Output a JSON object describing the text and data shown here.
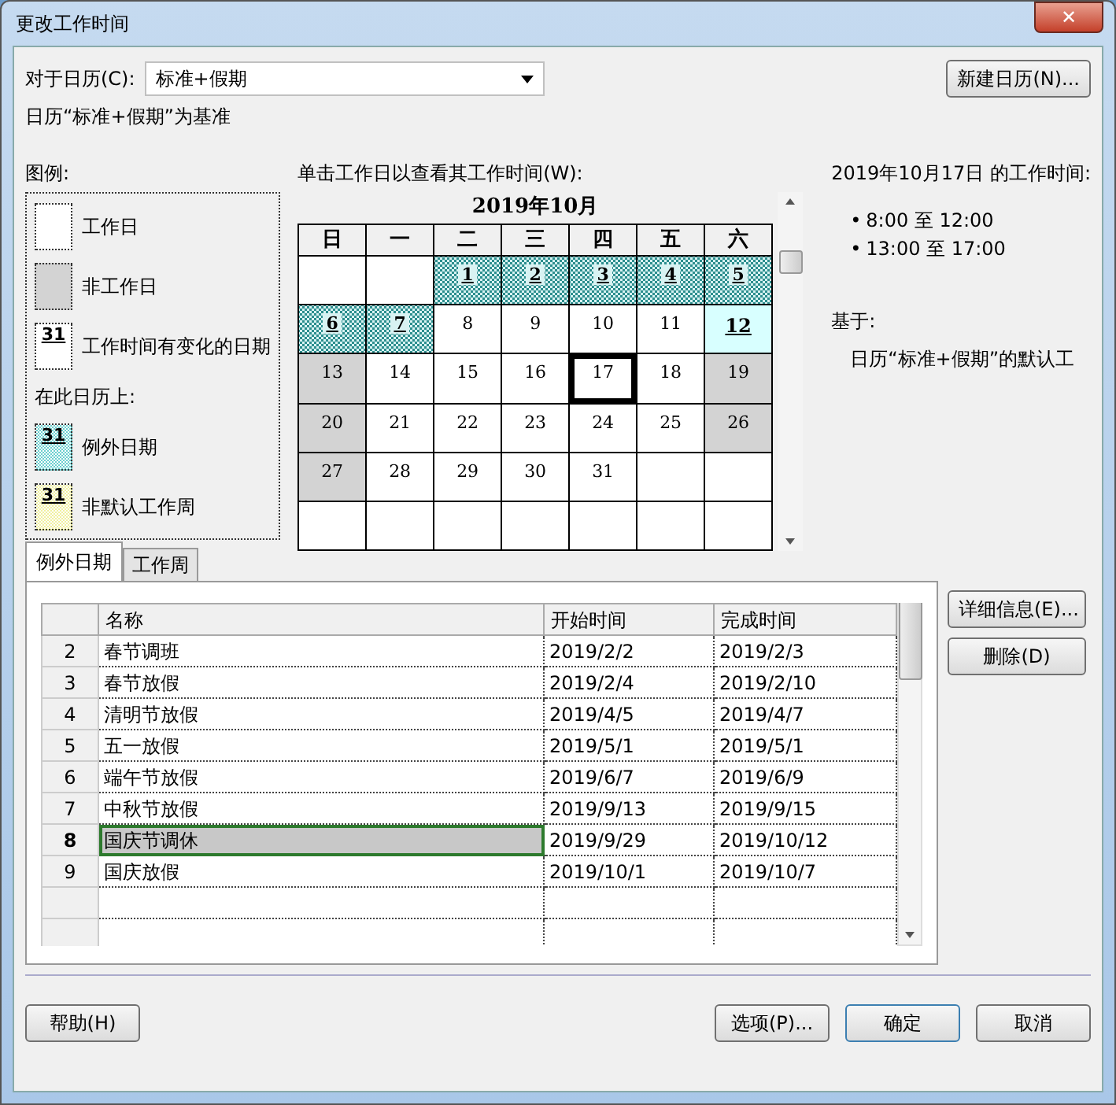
{
  "window": {
    "title": "更改工作时间",
    "close": "✕"
  },
  "calendar_field": {
    "label": "对于日历(C):",
    "value": "标准+假期"
  },
  "new_calendar_button": "新建日历(N)...",
  "base_note": "日历“标准+假期”为基准",
  "legend": {
    "title": "图例:",
    "subtitle": "在此日历上:",
    "items": [
      {
        "kind": "working",
        "label": "工作日"
      },
      {
        "kind": "nonworking",
        "label": "非工作日"
      },
      {
        "kind": "changed",
        "label": "工作时间有变化的日期",
        "sample": "31"
      },
      {
        "kind": "exception",
        "label": "例外日期",
        "sample": "31"
      },
      {
        "kind": "nondefault",
        "label": "非默认工作周",
        "sample": "31"
      }
    ]
  },
  "calendar": {
    "hint": "单击工作日以查看其工作时间(W):",
    "month": "2019年10月",
    "weekdays": [
      "日",
      "一",
      "二",
      "三",
      "四",
      "五",
      "六"
    ],
    "weeks": [
      [
        {
          "kind": "blank"
        },
        {
          "kind": "blank"
        },
        {
          "day": "1",
          "kind": "exception",
          "selected": false
        },
        {
          "day": "2",
          "kind": "exception",
          "selected": false
        },
        {
          "day": "3",
          "kind": "exception",
          "selected": false
        },
        {
          "day": "4",
          "kind": "exception",
          "selected": false
        },
        {
          "day": "5",
          "kind": "exception",
          "selected": false
        }
      ],
      [
        {
          "day": "6",
          "kind": "exception",
          "selected": false
        },
        {
          "day": "7",
          "kind": "exception",
          "selected": false
        },
        {
          "day": "8",
          "kind": "working",
          "selected": false
        },
        {
          "day": "9",
          "kind": "working",
          "selected": false
        },
        {
          "day": "10",
          "kind": "working",
          "selected": false
        },
        {
          "day": "11",
          "kind": "working",
          "selected": false
        },
        {
          "day": "12",
          "kind": "changed",
          "selected": false
        }
      ],
      [
        {
          "day": "13",
          "kind": "nonworking",
          "selected": false
        },
        {
          "day": "14",
          "kind": "working",
          "selected": false
        },
        {
          "day": "15",
          "kind": "working",
          "selected": false
        },
        {
          "day": "16",
          "kind": "working",
          "selected": false
        },
        {
          "day": "17",
          "kind": "working",
          "selected": true
        },
        {
          "day": "18",
          "kind": "working",
          "selected": false
        },
        {
          "day": "19",
          "kind": "nonworking",
          "selected": false
        }
      ],
      [
        {
          "day": "20",
          "kind": "nonworking",
          "selected": false
        },
        {
          "day": "21",
          "kind": "working",
          "selected": false
        },
        {
          "day": "22",
          "kind": "working",
          "selected": false
        },
        {
          "day": "23",
          "kind": "working",
          "selected": false
        },
        {
          "day": "24",
          "kind": "working",
          "selected": false
        },
        {
          "day": "25",
          "kind": "working",
          "selected": false
        },
        {
          "day": "26",
          "kind": "nonworking",
          "selected": false
        }
      ],
      [
        {
          "day": "27",
          "kind": "nonworking",
          "selected": false
        },
        {
          "day": "28",
          "kind": "working",
          "selected": false
        },
        {
          "day": "29",
          "kind": "working",
          "selected": false
        },
        {
          "day": "30",
          "kind": "working",
          "selected": false
        },
        {
          "day": "31",
          "kind": "working",
          "selected": false
        },
        {
          "kind": "blank"
        },
        {
          "kind": "blank"
        }
      ],
      [
        {
          "kind": "blank"
        },
        {
          "kind": "blank"
        },
        {
          "kind": "blank"
        },
        {
          "kind": "blank"
        },
        {
          "kind": "blank"
        },
        {
          "kind": "blank"
        },
        {
          "kind": "blank"
        }
      ]
    ]
  },
  "working_times": {
    "heading": "2019年10月17日 的工作时间:",
    "bullet": "•",
    "times": [
      "8:00 至 12:00",
      "13:00 至 17:00"
    ],
    "based_on_label": "基于:",
    "based_on": "日历“标准+假期”的默认工"
  },
  "tabs": [
    {
      "label": "例外日期",
      "selected": true
    },
    {
      "label": "工作周",
      "selected": false
    }
  ],
  "table": {
    "columns": [
      "名称",
      "开始时间",
      "完成时间"
    ],
    "rows": [
      {
        "id": "2",
        "name": "春节调班",
        "start": "2019/2/2",
        "finish": "2019/2/3",
        "selected": false
      },
      {
        "id": "3",
        "name": "春节放假",
        "start": "2019/2/4",
        "finish": "2019/2/10",
        "selected": false
      },
      {
        "id": "4",
        "name": "清明节放假",
        "start": "2019/4/5",
        "finish": "2019/4/7",
        "selected": false
      },
      {
        "id": "5",
        "name": "五一放假",
        "start": "2019/5/1",
        "finish": "2019/5/1",
        "selected": false
      },
      {
        "id": "6",
        "name": "端午节放假",
        "start": "2019/6/7",
        "finish": "2019/6/9",
        "selected": false
      },
      {
        "id": "7",
        "name": "中秋节放假",
        "start": "2019/9/13",
        "finish": "2019/9/15",
        "selected": false
      },
      {
        "id": "8",
        "name": "国庆节调休",
        "start": "2019/9/29",
        "finish": "2019/10/12",
        "selected": true
      },
      {
        "id": "9",
        "name": "国庆放假",
        "start": "2019/10/1",
        "finish": "2019/10/7",
        "selected": false
      }
    ]
  },
  "side_buttons": [
    "详细信息(E)...",
    "删除(D)"
  ],
  "footer_buttons": [
    "帮助(H)",
    "选项(P)...",
    "确定",
    "取消"
  ]
}
